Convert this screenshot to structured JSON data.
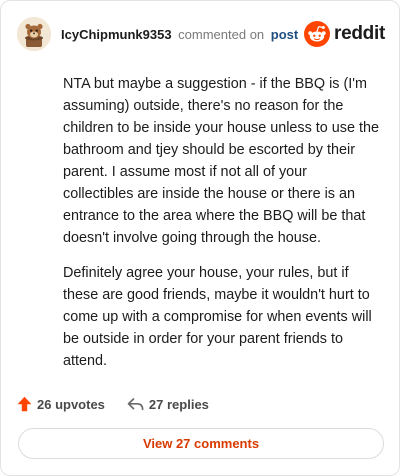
{
  "comment": {
    "author": "IcyChipmunk9353",
    "action_text": "commented on",
    "post_link_label": "post",
    "paragraphs": [
      "NTA but maybe a suggestion - if the BBQ is (I'm assuming) outside, there's no reason for the children to be inside your house unless to use the bathroom and tjey should be escorted by their parent. I assume most if not all of your collectibles are inside the house or there is an entrance to the area where the BBQ will be that doesn't involve going through the house.",
      "Definitely agree your house, your rules, but if these are good friends, maybe it wouldn't hurt to come up with a compromise for when events will be outside in order for your parent friends to attend."
    ],
    "upvotes_label": "26 upvotes",
    "replies_label": "27 replies"
  },
  "brand": {
    "name": "reddit",
    "logo_icon": "reddit-snoo-icon",
    "accent_color": "#ff4500"
  },
  "footer": {
    "view_comments_label": "View 27 comments"
  },
  "icons": {
    "upvote": "upvote-arrow-icon",
    "reply": "reply-arrow-icon",
    "avatar": "user-avatar"
  },
  "colors": {
    "upvote": "#ff4500",
    "view_button_text": "#d93a00",
    "post_link": "#1f4f80"
  }
}
